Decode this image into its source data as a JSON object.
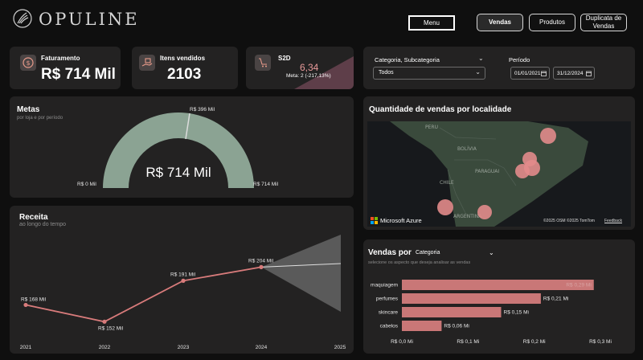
{
  "header": {
    "logo": "OPULINE",
    "nav": {
      "menu": "Menu",
      "vendas": "Vendas",
      "produtos": "Produtos",
      "duplicata": "Duplicata de Vendas"
    }
  },
  "kpis": {
    "faturamento": {
      "label": "Faturamento",
      "value": "R$ 714 Mil"
    },
    "itens": {
      "label": "Itens vendidos",
      "value": "2103"
    },
    "s2d": {
      "label": "S2D",
      "value": "6,34",
      "meta": "Meta: 2 (-217,13%)"
    }
  },
  "filters": {
    "categoria_label": "Categoria, Subcategoria",
    "categoria_value": "Todos",
    "periodo_label": "Período",
    "start_date": "01/01/2021",
    "end_date": "31/12/2024"
  },
  "metas": {
    "title": "Metas",
    "subtitle": "por loja e por período",
    "value": "R$ 714 Mil",
    "min_label": "R$ 0 Mil",
    "max_label": "R$ 714 Mil",
    "target_label": "R$ 396 Mil",
    "colors": {
      "fill": "#8ba393",
      "marker": "#dcdcdc"
    }
  },
  "map": {
    "title": "Quantidade de vendas por localidade",
    "labels": [
      "PERU",
      "BOLÍVIA",
      "PARAGUAI",
      "CHILE",
      "ARGENTINA"
    ],
    "brand": "Microsoft Azure",
    "copyright": "©2025 OSM ©2025 TomTom",
    "feedback": "Feedback"
  },
  "receita": {
    "title": "Receita",
    "subtitle": "ao longo do tempo",
    "chart_data": {
      "type": "line",
      "x": [
        "2021",
        "2022",
        "2023",
        "2024",
        "2025"
      ],
      "series": [
        {
          "values": [
            168,
            152,
            191,
            204,
            null
          ]
        }
      ],
      "data_labels": [
        "R$ 168 Mil",
        "R$ 152 Mil",
        "R$ 191 Mil",
        "R$ 204 Mil"
      ],
      "forecast": true,
      "colors": {
        "line": "#d87b7b",
        "forecast_band": "#5a5a5a",
        "forecast_line": "#e0e0e0"
      }
    }
  },
  "vendas_por": {
    "title": "Vendas por",
    "dropdown": "Categoria",
    "subtitle": "selecione os aspecto que deseja analisar as vendas",
    "chart_data": {
      "type": "bar",
      "orientation": "horizontal",
      "categories": [
        "maquiagem",
        "perfumes",
        "skincare",
        "cabelos"
      ],
      "values": [
        0.29,
        0.21,
        0.15,
        0.06
      ],
      "value_labels": [
        "R$ 0,29 Mi",
        "R$ 0,21 Mi",
        "R$ 0,15 Mi",
        "R$ 0,06 Mi"
      ],
      "xticks": [
        "R$ 0,0 Mi",
        "R$ 0,1 Mi",
        "R$ 0,2 Mi",
        "R$ 0,3 Mi"
      ],
      "xlim": [
        0,
        0.3
      ],
      "colors": {
        "bar": "#c97777"
      }
    }
  }
}
